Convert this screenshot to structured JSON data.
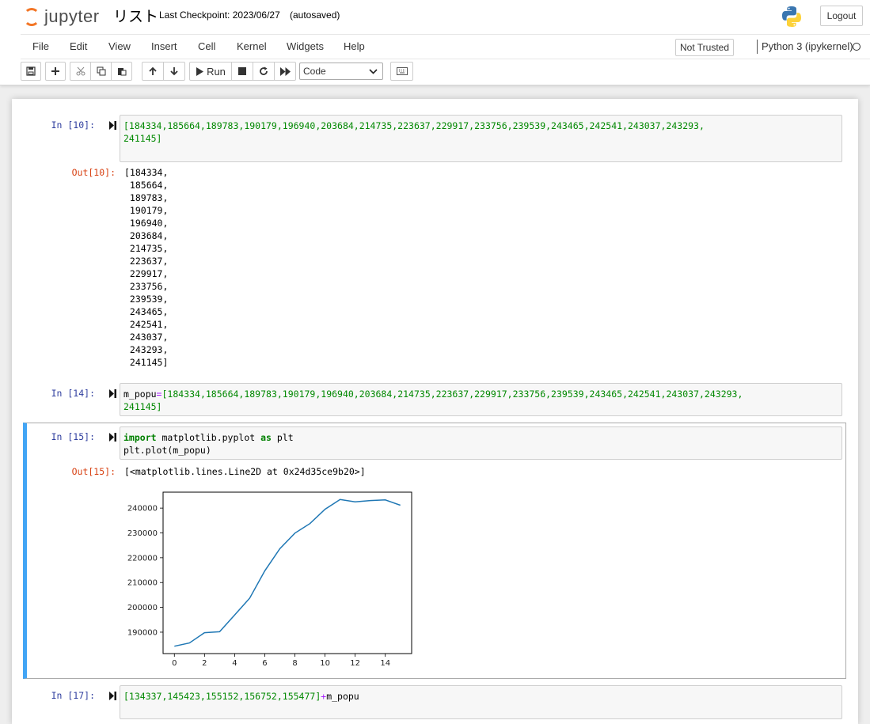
{
  "header": {
    "logo_text": "jupyter",
    "notebook_title": "リスト",
    "checkpoint": "Last Checkpoint: 2023/06/27",
    "autosave_status": "(autosaved)",
    "logout_label": "Logout"
  },
  "menu": {
    "items": [
      "File",
      "Edit",
      "View",
      "Insert",
      "Cell",
      "Kernel",
      "Widgets",
      "Help"
    ],
    "trust_label": "Not Trusted",
    "kernel_name": "Python 3 (ipykernel)"
  },
  "toolbar": {
    "run_label": "Run",
    "cell_type": "Code",
    "cell_type_options": [
      "Code"
    ]
  },
  "cells": {
    "c10": {
      "in_prompt": "In [10]:",
      "input_line1": "[184334,185664,189783,190179,196940,203684,214735,223637,229917,233756,239539,243465,242541,243037,243293,",
      "input_line2": "241145]",
      "out_prompt": "Out[10]:",
      "output_lines": [
        "[184334,",
        " 185664,",
        " 189783,",
        " 190179,",
        " 196940,",
        " 203684,",
        " 214735,",
        " 223637,",
        " 229917,",
        " 233756,",
        " 239539,",
        " 243465,",
        " 242541,",
        " 243037,",
        " 243293,",
        " 241145]"
      ]
    },
    "c14": {
      "in_prompt": "In [14]:",
      "var": "m_popu",
      "eq": "=",
      "input_line1": "[184334,185664,189783,190179,196940,203684,214735,223637,229917,233756,239539,243465,242541,243037,243293,",
      "input_line2": "241145]"
    },
    "c15": {
      "in_prompt": "In [15]:",
      "kw_import": "import",
      "module": " matplotlib.pyplot ",
      "kw_as": "as",
      "alias": " plt",
      "line2": "plt.plot(m_popu)",
      "out_prompt": "Out[15]:",
      "output_text": "[<matplotlib.lines.Line2D at 0x24d35ce9b20>]"
    },
    "c17": {
      "in_prompt": "In [17]:",
      "list_part": "[134337,145423,155152,156752,155477]",
      "plus": "+",
      "var": "m_popu"
    }
  },
  "colors": {
    "accent": "#42a5f5",
    "line": "#1f77b4",
    "logo_orange": "#f37626"
  },
  "icons": [
    "save-icon",
    "plus-icon",
    "cut-icon",
    "copy-icon",
    "paste-icon",
    "arrow-up-icon",
    "arrow-down-icon",
    "play-icon",
    "stop-icon",
    "restart-icon",
    "fast-forward-icon",
    "keyboard-icon",
    "python-logo-icon",
    "kernel-status-icon",
    "run-indicator-icon"
  ],
  "chart_data": {
    "type": "line",
    "x": [
      0,
      1,
      2,
      3,
      4,
      5,
      6,
      7,
      8,
      9,
      10,
      11,
      12,
      13,
      14,
      15
    ],
    "values": [
      184334,
      185664,
      189783,
      190179,
      196940,
      203684,
      214735,
      223637,
      229917,
      233756,
      239539,
      243465,
      242541,
      243037,
      243293,
      241145
    ],
    "xticks": [
      0,
      2,
      4,
      6,
      8,
      10,
      12,
      14
    ],
    "yticks": [
      190000,
      200000,
      210000,
      220000,
      230000,
      240000
    ],
    "xlim": [
      -0.75,
      15.75
    ],
    "ylim": [
      181378,
      246421
    ],
    "title": "",
    "xlabel": "",
    "ylabel": "",
    "grid": false
  }
}
